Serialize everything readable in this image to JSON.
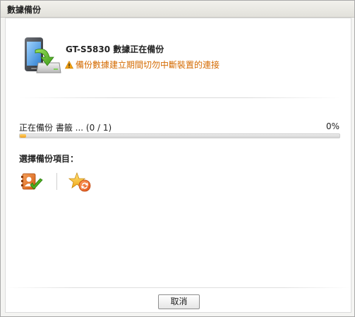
{
  "window": {
    "title": "數據備份"
  },
  "device": {
    "title": "GT-S5830 數據正在備份",
    "warning": "備份數據建立期間切勿中斷裝置的連接",
    "icon": "phone-sync-icon"
  },
  "progress": {
    "label": "正在備份 書籤 ... (0 / 1)",
    "percent_text": "0%",
    "value": 0.02
  },
  "items_section": {
    "label": "選擇備份項目：",
    "items": [
      {
        "icon": "contacts-check-icon"
      },
      {
        "icon": "bookmark-star-sync-icon"
      }
    ]
  },
  "buttons": {
    "cancel": "取消"
  },
  "colors": {
    "warning": "#d46a00",
    "progress_fill": "#f0a020"
  }
}
